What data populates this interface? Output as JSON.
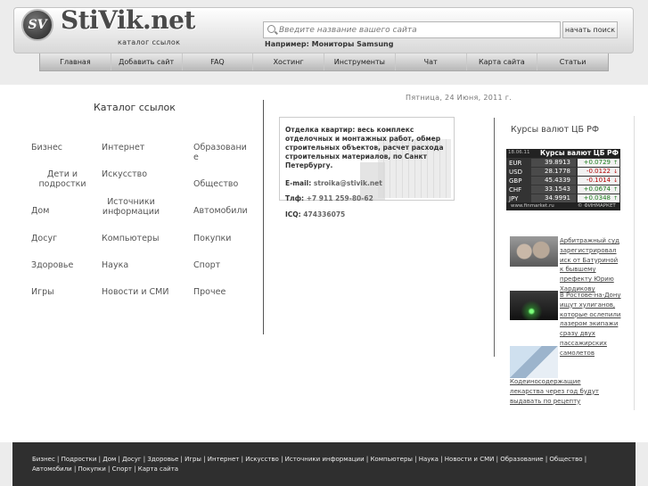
{
  "header": {
    "logo_mark": "SV",
    "logo_text": "StiVik.net",
    "logo_subtitle": "каталог ссылок",
    "search_placeholder": "Введите название вашего сайта",
    "search_button": "начать поиск",
    "example_text": "Например: Мониторы Samsung"
  },
  "nav": [
    "Главная",
    "Добавить сайт",
    "FAQ",
    "Хостинг",
    "Инструменты",
    "Чат",
    "Карта сайта",
    "Статьи"
  ],
  "date": "Пятница, 24  Июня,  2011 г.",
  "catalog": {
    "title": "Каталог ссылок",
    "col1": [
      "Бизнес",
      "Дети и подростки",
      "Дом",
      "Досуг",
      "Здоровье",
      "Игры"
    ],
    "col2": [
      "Интернет",
      "Искусство",
      "Источники информации",
      "Компьютеры",
      "Наука",
      "Новости и СМИ"
    ],
    "col3": [
      "Образование",
      "Общество",
      "Автомобили",
      "Покупки",
      "Спорт",
      "Прочее"
    ]
  },
  "ad": {
    "text": "Отделка квартир: весь комплекс отделочных и монтажных работ, обмер строительных объектов, расчет расхода строительных материалов, по Санкт Петербургу.",
    "email_label": "E-mail:",
    "email": "stroika@stivik.net",
    "phone_label": "Тлф:",
    "phone": "+7 911 259-80-62",
    "icq_label": "ICQ:",
    "icq": "474336075"
  },
  "rates": {
    "title": "Курсы валют ЦБ РФ",
    "widget_date": "18.06.11",
    "widget_title": "Курсы валют ЦБ РФ",
    "rows": [
      {
        "code": "EUR",
        "value": "39.8913",
        "change": "+0.0729",
        "dir": "up"
      },
      {
        "code": "USD",
        "value": "28.1778",
        "change": "-0.0122",
        "dir": "down"
      },
      {
        "code": "GBP",
        "value": "45.4339",
        "change": "-0.1014",
        "dir": "down"
      },
      {
        "code": "CHF",
        "value": "33.1543",
        "change": "+0.0674",
        "dir": "up"
      },
      {
        "code": "JPY",
        "value": "34.9991",
        "change": "+0.0348",
        "dir": "up"
      }
    ],
    "footer_left": "www.finmarket.ru",
    "footer_right": "© ФИНМАРКЕТ"
  },
  "news": [
    {
      "text": "Арбитражный суд зарегистрировал иск от Батуриной к бывшему префекту Юрию Хардикову"
    },
    {
      "text": "В Ростове-на-Дону ищут хулиганов, которые ослепили лазером экипажи сразу двух пассажирских самолетов"
    },
    {
      "text": "Кодеиносодержащие лекарства через год будут выдавать по рецепту"
    }
  ],
  "footer": {
    "links": [
      "Бизнес",
      "Подростки",
      "Дом",
      "Досуг",
      "Здоровье",
      "Игры",
      "Интернет",
      "Искусство",
      "Источники информации",
      "Компьютеры",
      "Наука",
      "Новости и СМИ",
      "Образование",
      "Общество",
      "Автомобили",
      "Покупки",
      "Спорт",
      "Карта сайта"
    ]
  },
  "colors": {
    "accent": "#2f2f2f",
    "up": "#1a7a1a",
    "down": "#b00000"
  }
}
